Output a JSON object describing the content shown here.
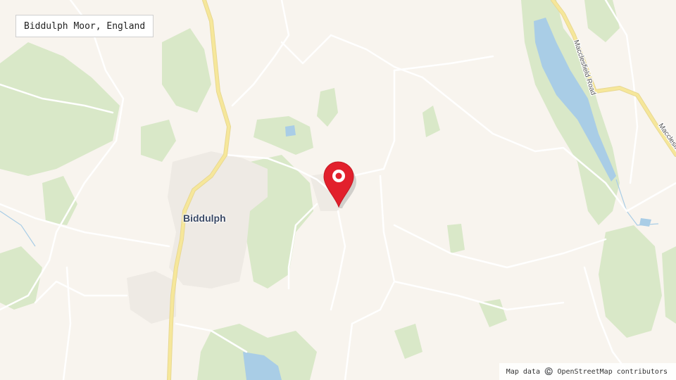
{
  "location": {
    "title": "Biddulph Moor, England"
  },
  "labels": {
    "town": "Biddulph",
    "road_1": "Macclesfield Road",
    "road_2": "Macclesfie"
  },
  "attribution": "Map data ©️ OpenStreetMap contributors",
  "icons": {
    "marker": "map-pin-icon"
  },
  "colors": {
    "background": "#f8f4ee",
    "woodland": "#d9e8c8",
    "water": "#a9cde6",
    "major_road": "#f6e79a",
    "minor_road": "#ffffff",
    "pin": "#e2202c",
    "town_label": "#3b4a66"
  }
}
